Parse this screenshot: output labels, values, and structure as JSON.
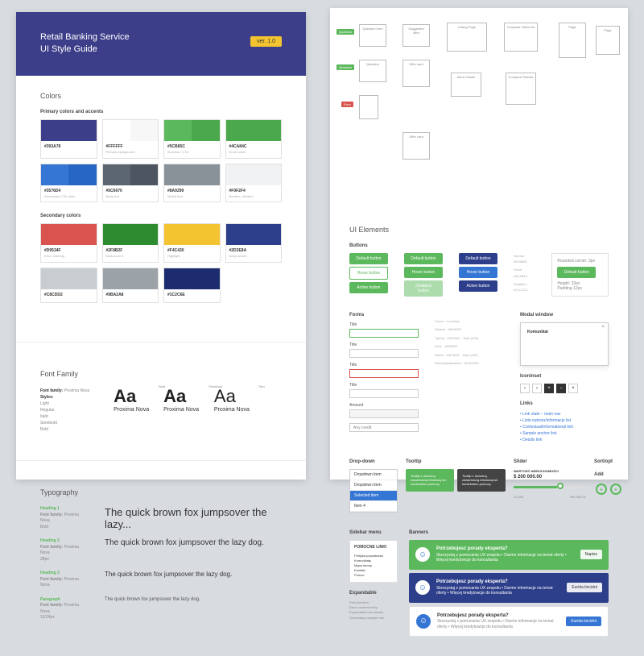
{
  "header": {
    "title_line1": "Retail Banking Service",
    "title_line2": "UI Style Guide",
    "version": "ver. 1.0"
  },
  "colors": {
    "section_title": "Colors",
    "primary_label": "Primary colors and accents",
    "secondary_label": "Secondary colors",
    "primary": [
      {
        "hex": "#393A78",
        "c1": "#3d3e8a",
        "c2": "#3d3e8a",
        "desc": ""
      },
      {
        "hex": "#FFFFFF",
        "c1": "#ffffff",
        "c2": "#f7f7f7",
        "desc": "Primary background"
      },
      {
        "hex": "#5CB85C",
        "c1": "#5cb85c",
        "c2": "#4ca84c",
        "desc": "Success / CTA"
      },
      {
        "hex": "#4CA84C",
        "c1": "#4ca84c",
        "c2": "#4ca84c",
        "desc": "Hover state"
      },
      {
        "hex": "#3576D4",
        "c1": "#3576d4",
        "c2": "#2866c4",
        "desc": "Secondary CTA, links"
      },
      {
        "hex": "#5C6670",
        "c1": "#5c6670",
        "c2": "#4d5660",
        "desc": "Body text"
      },
      {
        "hex": "#8A9299",
        "c1": "#8a9299",
        "c2": "#8a9299",
        "desc": "Muted text"
      },
      {
        "hex": "#F0F2F4",
        "c1": "#f0f2f4",
        "c2": "#f0f2f4",
        "desc": "Borders, dividers"
      }
    ],
    "secondary": [
      {
        "hex": "#D9534F",
        "c": "#d9534f",
        "desc": "Error, warning"
      },
      {
        "hex": "#2F8B2F",
        "c": "#2f8b2f",
        "desc": "Dark accent"
      },
      {
        "hex": "#F4C430",
        "c": "#f4c430",
        "desc": "Highlight"
      },
      {
        "hex": "#2D3E8A",
        "c": "#2d3e8a",
        "desc": "Navy accent"
      },
      {
        "hex": "#C8CDD2",
        "c": "#c8cdd2",
        "desc": ""
      },
      {
        "hex": "#9BA2A8",
        "c": "#9ba2a8",
        "desc": ""
      },
      {
        "hex": "#1C2C6E",
        "c": "#1c2c6e",
        "desc": ""
      }
    ]
  },
  "font": {
    "section_title": "Font Family",
    "family_label": "Font family:",
    "family": "Proxima Nova",
    "styles_label": "Styles:",
    "styles": "Light\nRegular\nItalic\nSemibold\nBold",
    "aa": "Aa",
    "name": "Proxima Nova",
    "w1": "Bold",
    "w2": "Semibold",
    "w3": "Thin"
  },
  "typography": {
    "section_title": "Typography",
    "headings": [
      {
        "name": "Heading 1",
        "meta": "Proxima Nova\nBold",
        "sample": "The quick brown fox jumpsover the lazy...",
        "cls": "typo-1"
      },
      {
        "name": "Heading 2",
        "meta": "Proxima Nova\n28px",
        "sample": "The quick brown fox jumpsover the lazy dog.",
        "cls": "typo-2"
      },
      {
        "name": "Heading 3",
        "meta": "Proxima Nova",
        "sample": "The quick brown fox jumpsover the lazy dog.",
        "cls": "typo-3"
      },
      {
        "name": "Paragraph",
        "meta": "Proxima Nova\n12/24px",
        "sample": "The quick brown fox jumpsover the lazy dog.",
        "cls": "typo-4"
      }
    ]
  },
  "flow": {
    "nodes": [
      "Question form",
      "Suggested offer",
      "Listing Page",
      "Compare Offers list",
      "Page",
      "Page",
      "Question",
      "Offer card",
      "More Details",
      "Compare Results",
      "Offer card"
    ],
    "tags": [
      "Question",
      "Question",
      "Error"
    ]
  },
  "ui": {
    "section_title": "UI Elements",
    "buttons_label": "Buttons",
    "btn_default": "Default button",
    "btn_active": "Active button",
    "btn_disabled": "Disabled button",
    "btn_hover": "Hover button",
    "state_normal": "Normal · #5CB85C",
    "state_hover": "Hover · #4CA84C",
    "state_disabled": "Disabled · #C1C1C1",
    "corner_title": "Rounded corner: 3px",
    "corner_height": "Height: 32px",
    "padding": "Padding 12px",
    "forms_label": "Forms",
    "field_title": "Title",
    "hint_focus": "Focus · on-active",
    "hint_default": "Default · #AFAFAF",
    "hint_typing": "Typing · #3F4A51 · 16px (400)",
    "hint_error": "Error · #D9534F",
    "hint_select": "Select · #3F4A51 · 16px (400)",
    "hint_readonly": "Readonly/disabled · #C8CDD2",
    "ph_amount": "Amount",
    "ph_select": "Any credit",
    "modal_label": "Modal window",
    "modal_title": "Komunikat",
    "iconset_label": "Iconinset",
    "links_label": "Links",
    "links": [
      "Link state – main nav",
      "Lista wyboru/informacje list",
      "Contextual/informational link",
      "Sample anchor link",
      "Details link"
    ],
    "dropdown_label": "Drop-down",
    "dropdown_items": [
      "Dropdown item",
      "Dropdown item",
      "Selected item",
      "Item 4"
    ],
    "tooltip_label": "Tooltip",
    "tooltip_text": "Tooltip z dowolną zawartością tekstową lub kontekstem pomocy.",
    "slider_label": "Slider",
    "slider_title": "WARTOŚĆ NIERUCHOMOŚCI",
    "slider_val": "$ 200 000.00",
    "slider_min": "10 000",
    "slider_max": "500 000.01",
    "sortopt_label": "Sort/opt",
    "add_label": "Add",
    "sidebar_label": "Sidebar menu",
    "sidebar_title": "POMOCNE LINKI",
    "sidebar_items": [
      "Polityka prywatności",
      "Komunikaty",
      "Mapa strony",
      "Kontakt",
      "Pomoc"
    ],
    "expandable_label": "Expandable",
    "exp_items": [
      "First line item",
      "Demo content entry",
      "Expandable row header",
      "Secondary example row"
    ],
    "banners_label": "Banners",
    "banner_title": "Potrzebujesz",
    "banner_sub": "porady eksperta?",
    "banner_desc": "Skorzystaj z pomocania UX zespołu • Darmo informacje na temat oferty • Więcej kredytowcje do konsultanta",
    "banner_btn1": "Napisz",
    "banner_btn2": "Eurida tincidnt"
  }
}
